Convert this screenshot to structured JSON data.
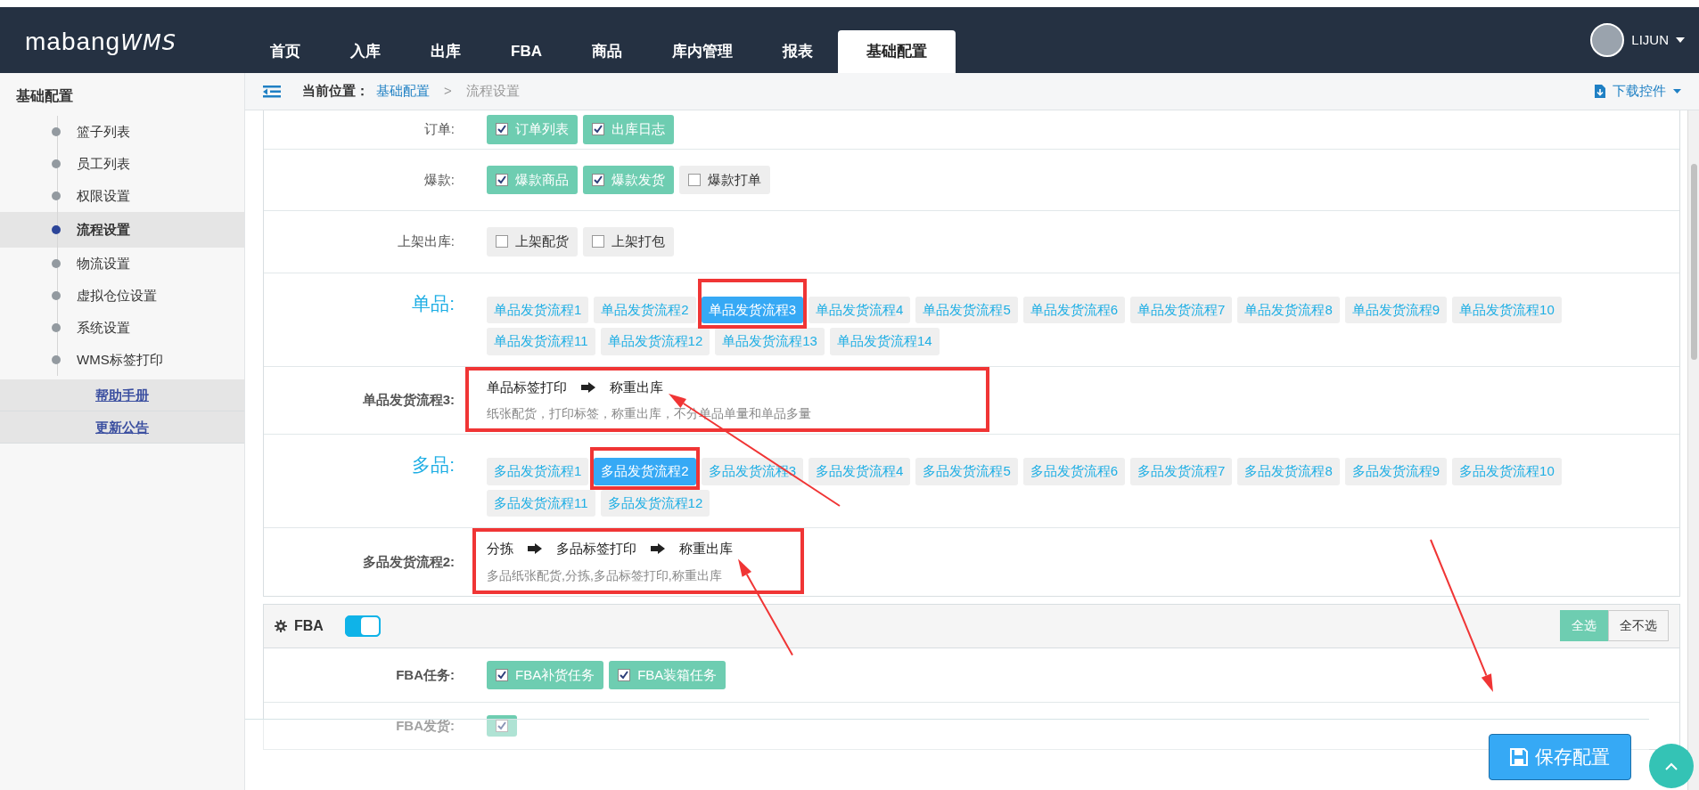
{
  "logo": {
    "name": "mabang",
    "suffix": "WMS"
  },
  "nav": [
    {
      "label": "首页",
      "selected": false
    },
    {
      "label": "入库",
      "selected": false
    },
    {
      "label": "出库",
      "selected": false
    },
    {
      "label": "FBA",
      "selected": false
    },
    {
      "label": "商品",
      "selected": false
    },
    {
      "label": "库内管理",
      "selected": false
    },
    {
      "label": "报表",
      "selected": false
    },
    {
      "label": "基础配置",
      "selected": true
    }
  ],
  "user": {
    "name": "LIJUN"
  },
  "sidebar": {
    "title": "基础配置",
    "items": [
      {
        "label": "篮子列表",
        "selected": false
      },
      {
        "label": "员工列表",
        "selected": false
      },
      {
        "label": "权限设置",
        "selected": false
      },
      {
        "label": "流程设置",
        "selected": true
      },
      {
        "label": "物流设置",
        "selected": false
      },
      {
        "label": "虚拟仓位设置",
        "selected": false
      },
      {
        "label": "系统设置",
        "selected": false
      },
      {
        "label": "WMS标签打印",
        "selected": false
      }
    ],
    "links": [
      "帮助手册",
      "更新公告"
    ]
  },
  "breadcrumb": {
    "label": "当前位置：",
    "items": [
      "基础配置",
      "流程设置"
    ],
    "separator": ">"
  },
  "download": "下载控件",
  "settings": [
    {
      "kind": "checks",
      "label": "订单:",
      "options": [
        {
          "label": "订单列表",
          "checked": true
        },
        {
          "label": "出库日志",
          "checked": true
        }
      ]
    },
    {
      "kind": "checks",
      "label": "爆款:",
      "options": [
        {
          "label": "爆款商品",
          "checked": true
        },
        {
          "label": "爆款发货",
          "checked": true
        },
        {
          "label": "爆款打单",
          "checked": false
        }
      ]
    },
    {
      "kind": "checks",
      "label": "上架出库:",
      "options": [
        {
          "label": "上架配货",
          "checked": false
        },
        {
          "label": "上架打包",
          "checked": false
        }
      ]
    },
    {
      "kind": "flows",
      "label": "单品:",
      "options": [
        {
          "label": "单品发货流程1",
          "selected": false
        },
        {
          "label": "单品发货流程2",
          "selected": false
        },
        {
          "label": "单品发货流程3",
          "selected": true
        },
        {
          "label": "单品发货流程4",
          "selected": false
        },
        {
          "label": "单品发货流程5",
          "selected": false
        },
        {
          "label": "单品发货流程6",
          "selected": false
        },
        {
          "label": "单品发货流程7",
          "selected": false
        },
        {
          "label": "单品发货流程8",
          "selected": false
        },
        {
          "label": "单品发货流程9",
          "selected": false
        },
        {
          "label": "单品发货流程10",
          "selected": false
        },
        {
          "label": "单品发货流程11",
          "selected": false
        },
        {
          "label": "单品发货流程12",
          "selected": false
        },
        {
          "label": "单品发货流程13",
          "selected": false
        },
        {
          "label": "单品发货流程14",
          "selected": false
        }
      ]
    },
    {
      "kind": "flow",
      "label": "单品发货流程3:",
      "steps": [
        "单品标签打印",
        "称重出库"
      ],
      "description": "纸张配货，打印标签，称重出库，不分单品单量和单品多量"
    },
    {
      "kind": "flows",
      "label": "多品:",
      "options": [
        {
          "label": "多品发货流程1",
          "selected": false
        },
        {
          "label": "多品发货流程2",
          "selected": true
        },
        {
          "label": "多品发货流程3",
          "selected": false
        },
        {
          "label": "多品发货流程4",
          "selected": false
        },
        {
          "label": "多品发货流程5",
          "selected": false
        },
        {
          "label": "多品发货流程6",
          "selected": false
        },
        {
          "label": "多品发货流程7",
          "selected": false
        },
        {
          "label": "多品发货流程8",
          "selected": false
        },
        {
          "label": "多品发货流程9",
          "selected": false
        },
        {
          "label": "多品发货流程10",
          "selected": false
        },
        {
          "label": "多品发货流程11",
          "selected": false
        },
        {
          "label": "多品发货流程12",
          "selected": false
        }
      ]
    },
    {
      "kind": "flow",
      "label": "多品发货流程2:",
      "steps": [
        "分拣",
        "多品标签打印",
        "称重出库"
      ],
      "description": "多品纸张配货,分拣,多品标签打印,称重出库"
    }
  ],
  "fba": {
    "title": "FBA",
    "enabled": true,
    "buttons": [
      {
        "label": "全选",
        "selected": true
      },
      {
        "label": "全不选",
        "selected": false
      }
    ],
    "rows": [
      {
        "label": "FBA任务:",
        "options": [
          {
            "label": "FBA补货任务",
            "checked": true
          },
          {
            "label": "FBA装箱任务",
            "checked": true
          }
        ]
      },
      {
        "label": "FBA发货:",
        "options": [
          {
            "checked": true
          }
        ]
      }
    ]
  },
  "save_button": "保存配置"
}
